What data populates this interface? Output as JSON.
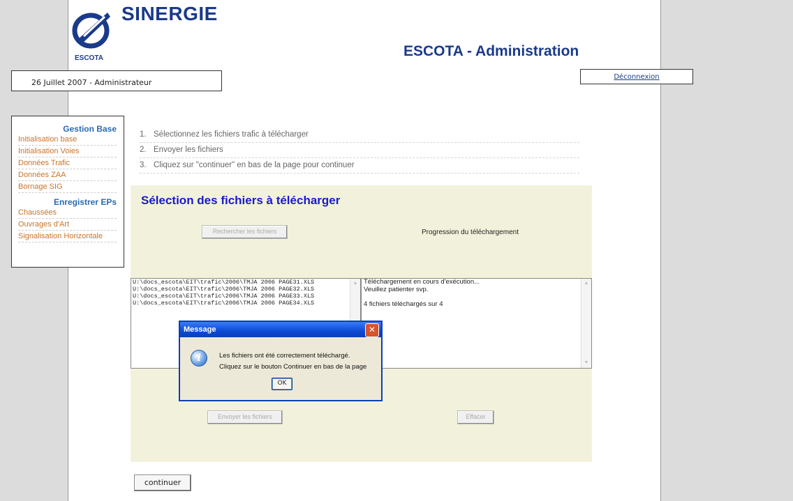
{
  "header": {
    "brand": "SINERGIE",
    "logo_sub": "ESCOTA",
    "title": "ESCOTA - Administration",
    "date_user": "26 Juillet 2007 - Administrateur",
    "logout_label": "Déconnexion"
  },
  "sidebar": {
    "section1": "Gestion Base",
    "items1": [
      "Initialisation base",
      "Initialisation Voies",
      "Données Trafic",
      "Données ZAA",
      "Bornage SIG"
    ],
    "section2": "Enregistrer EPs",
    "items2": [
      "Chaussées",
      "Ouvrages d'Art",
      "Signalisation Horizontale"
    ]
  },
  "steps": [
    {
      "num": "1.",
      "text": "Sélectionnez les fichiers trafic à télécharger"
    },
    {
      "num": "2.",
      "text": "Envoyer les fichiers"
    },
    {
      "num": "3.",
      "text": "Cliquez sur \"continuer\" en bas de la page pour continuer"
    }
  ],
  "main": {
    "title": "Sélection des fichiers à télécharger",
    "browse_button": "Rechercher les fichiers",
    "progress_label": "Progression du téléchargement",
    "files": [
      "U:\\docs_escota\\EIT\\trafic\\2006\\TMJA 2006 PAGE31.XLS",
      "U:\\docs_escota\\EIT\\trafic\\2006\\TMJA 2006 PAGE32.XLS",
      "U:\\docs_escota\\EIT\\trafic\\2006\\TMJA 2006 PAGE33.XLS",
      "U:\\docs_escota\\EIT\\trafic\\2006\\TMJA 2006 PAGE34.XLS"
    ],
    "status_lines": [
      "Téléchargement en cours d'exécution...",
      "Veuillez patienter svp.",
      "",
      "4 fichiers téléchargés sur 4"
    ],
    "send_button": "Envoyer les fichiers",
    "clear_button": "Effacer",
    "continue_button": "continuer"
  },
  "dialog": {
    "title": "Message",
    "line1": "Les fichiers ont été correctement téléchargé.",
    "line2": "Cliquez sur le bouton Continuer en bas de la page",
    "ok": "OK"
  }
}
